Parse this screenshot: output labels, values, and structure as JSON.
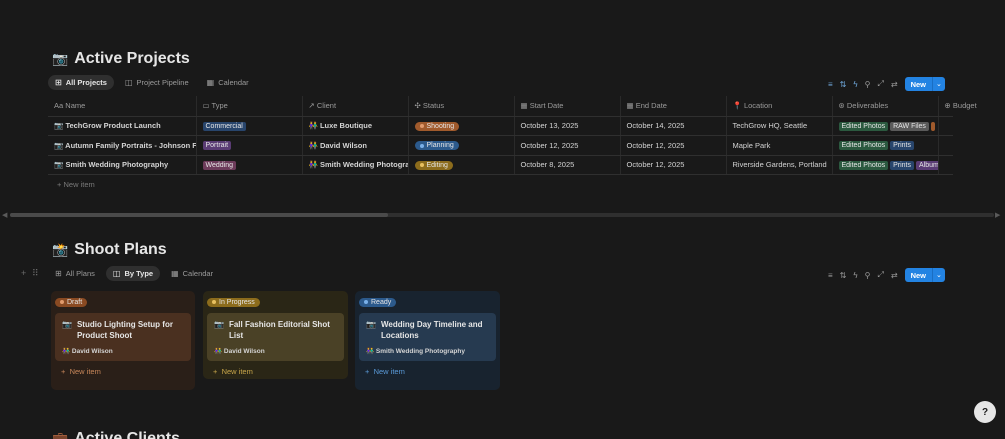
{
  "projects": {
    "emoji": "📷",
    "title": "Active Projects",
    "tabs": [
      {
        "label": "All Projects",
        "icon": "table-icon",
        "glyph": "⊞"
      },
      {
        "label": "Project Pipeline",
        "icon": "board-icon",
        "glyph": "◫"
      },
      {
        "label": "Calendar",
        "icon": "calendar-icon",
        "glyph": "▦"
      }
    ],
    "new_label": "New",
    "columns": [
      {
        "label": "Name",
        "glyph": "Aa"
      },
      {
        "label": "Type",
        "glyph": "▭"
      },
      {
        "label": "Client",
        "glyph": "↗"
      },
      {
        "label": "Status",
        "glyph": "✣"
      },
      {
        "label": "Start Date",
        "glyph": "▦"
      },
      {
        "label": "End Date",
        "glyph": "▦"
      },
      {
        "label": "Location",
        "glyph": "📍"
      },
      {
        "label": "Deliverables",
        "glyph": "⊛"
      },
      {
        "label": "Budget",
        "glyph": "⊕"
      }
    ],
    "rows": [
      {
        "name": "TechGrow Product Launch",
        "type": "Commercial",
        "client": "Luxe Boutique",
        "status": "Shooting",
        "start": "October 13, 2025",
        "end": "October 14, 2025",
        "location": "TechGrow HQ, Seattle",
        "deliverables": [
          "Edited Photos",
          "RAW Files"
        ]
      },
      {
        "name": "Autumn Family Portraits - Johnson Family",
        "type": "Portrait",
        "client": "David Wilson",
        "status": "Planning",
        "start": "October 12, 2025",
        "end": "October 12, 2025",
        "location": "Maple Park",
        "deliverables": [
          "Edited Photos",
          "Prints"
        ]
      },
      {
        "name": "Smith Wedding Photography",
        "type": "Wedding",
        "client": "Smith Wedding Photography",
        "status": "Editing",
        "start": "October 8, 2025",
        "end": "October 12, 2025",
        "location": "Riverside Gardens, Portland",
        "deliverables": [
          "Edited Photos",
          "Prints",
          "Album"
        ]
      }
    ],
    "new_item": "New item"
  },
  "plans": {
    "emoji": "📸",
    "title": "Shoot Plans",
    "tabs": [
      {
        "label": "All Plans",
        "glyph": "⊞"
      },
      {
        "label": "By Type",
        "glyph": "◫"
      },
      {
        "label": "Calendar",
        "glyph": "▦"
      }
    ],
    "new_label": "New",
    "columns": [
      {
        "label": "Draft",
        "card": {
          "title": "Studio Lighting Setup for Product Shoot",
          "who": "David Wilson"
        },
        "new_item": "New item"
      },
      {
        "label": "In Progress",
        "card": {
          "title": "Fall Fashion Editorial Shot List",
          "who": "David Wilson"
        },
        "new_item": "New item"
      },
      {
        "label": "Ready",
        "card": {
          "title": "Wedding Day Timeline and Locations",
          "who": "Smith Wedding Photography"
        },
        "new_item": "New item"
      }
    ]
  },
  "clients": {
    "emoji": "💼",
    "title": "Active Clients"
  },
  "colors": {
    "accent": "#2383e2",
    "commercial": "#28456c",
    "portrait": "#5a3c74",
    "wedding": "#6c3b5a",
    "shooting": "#a05a2c",
    "planning": "#2c5a8c",
    "editing": "#8c6c1c",
    "edited_photos": "#2b593f",
    "raw_files": "#5a5a5a",
    "prints": "#28456c",
    "album": "#5a3c74"
  }
}
